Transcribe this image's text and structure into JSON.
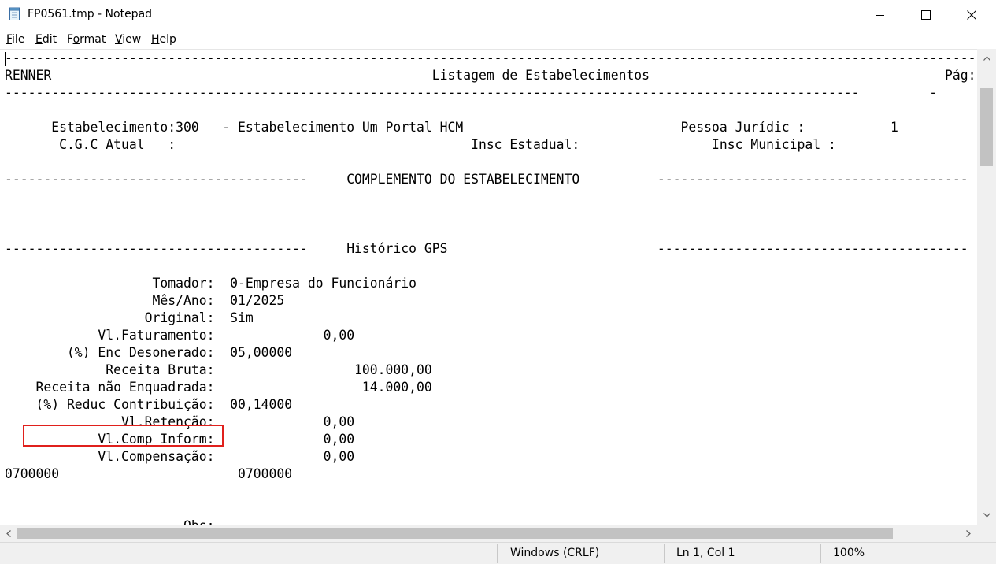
{
  "window": {
    "title": "FP0561.tmp - Notepad",
    "controls": {
      "minimize": "minimize",
      "maximize": "maximize",
      "close": "close"
    }
  },
  "menu": {
    "items": [
      {
        "accel": "F",
        "rest": "ile"
      },
      {
        "accel": "E",
        "rest": "dit"
      },
      {
        "accel": "o",
        "pre": "F",
        "rest": "rmat"
      },
      {
        "accel": "V",
        "rest": "iew"
      },
      {
        "accel": "H",
        "rest": "elp"
      }
    ]
  },
  "document": {
    "lines": [
      "------------------------------------------------------------------------------------------------------------------------------",
      "RENNER                                                 Listagem de Estabelecimentos                                      Pág:",
      "--------------------------------------------------------------------------------------------------------------         -",
      "",
      "      Estabelecimento:300   - Estabelecimento Um Portal HCM                            Pessoa Jurídic :           1",
      "       C.G.C Atual   :                                      Insc Estadual:                 Insc Municipal :",
      "",
      "---------------------------------------     COMPLEMENTO DO ESTABELECIMENTO          ----------------------------------------",
      "",
      "",
      "",
      "---------------------------------------     Histórico GPS                           ----------------------------------------",
      "",
      "                   Tomador:  0-Empresa do Funcionário",
      "                   Mês/Ano:  01/2025",
      "                  Original:  Sim",
      "            Vl.Faturamento:              0,00",
      "        (%) Enc Desonerado:  05,00000",
      "             Receita Bruta:                  100.000,00",
      "    Receita não Enquadrada:                   14.000,00",
      "    (%) Reduc Contribuição:  00,14000",
      "               Vl.Retenção:              0,00",
      "            Vl.Comp Inform:              0,00",
      "            Vl.Compensação:              0,00",
      "0700000                       0700000",
      "",
      "",
      "                       Obs:"
    ]
  },
  "status": {
    "line_ending": "Windows (CRLF)",
    "position": "Ln 1, Col 1",
    "zoom": "100%"
  },
  "colors": {
    "highlight_border": "#e0201c",
    "scrollbar_track": "#f0f0f0",
    "scrollbar_thumb": "#c2c2c2"
  }
}
